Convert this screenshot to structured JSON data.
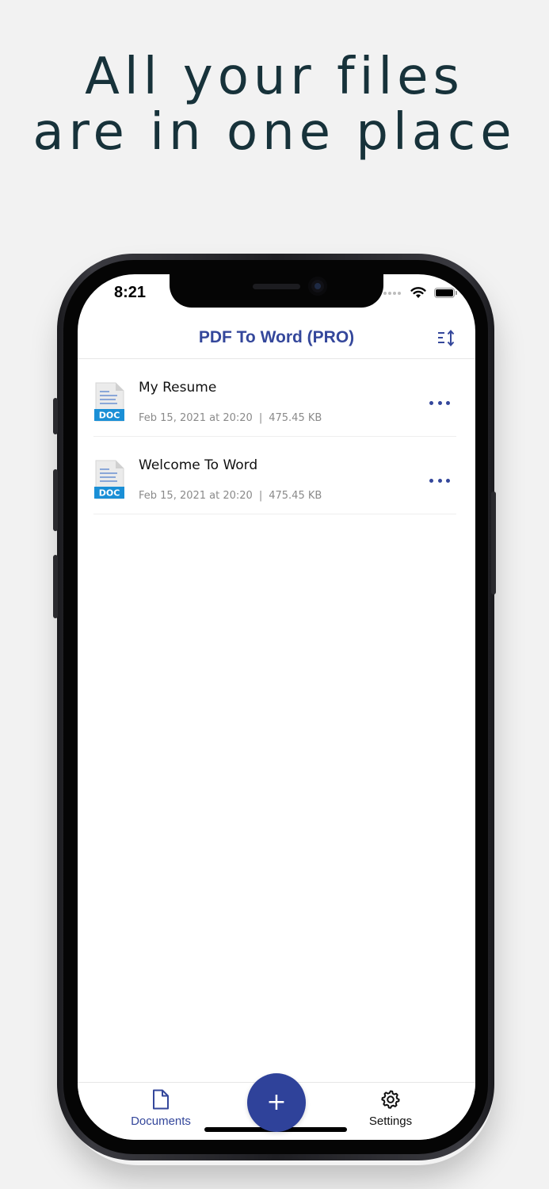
{
  "promo": {
    "line1": "All your files",
    "line2": "are in one place"
  },
  "status_bar": {
    "time": "8:21",
    "icons": [
      "signal-dots-icon",
      "wifi-icon",
      "battery-icon"
    ]
  },
  "navbar": {
    "title": "PDF To Word (PRO)",
    "sort_icon": "sort-icon"
  },
  "documents": [
    {
      "name": "My Resume",
      "date": "Feb 15, 2021 at 20:20",
      "separator": "|",
      "size": "475.45 KB",
      "icon_badge": "DOC"
    },
    {
      "name": "Welcome To Word",
      "date": "Feb 15, 2021 at 20:20",
      "separator": "|",
      "size": "475.45 KB",
      "icon_badge": "DOC"
    }
  ],
  "tabbar": {
    "documents_label": "Documents",
    "settings_label": "Settings",
    "fab_label": "+"
  },
  "colors": {
    "accent": "#34479b",
    "fab": "#2f429a",
    "headline": "#17323a",
    "doc_badge": "#1a8fd6",
    "background": "#f2f2f2"
  }
}
